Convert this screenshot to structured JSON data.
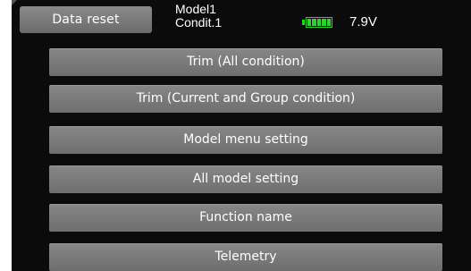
{
  "header": {
    "title": "Data reset",
    "model_name": "Model1",
    "condition": "Condit.1",
    "voltage": "7.9V",
    "battery_icon": "battery-icon",
    "battery_color": "#2bd42b"
  },
  "menu": {
    "items": [
      {
        "label": "Trim (All condition)"
      },
      {
        "label": "Trim (Current and Group condition)"
      },
      {
        "label": "Model menu setting"
      },
      {
        "label": "All model setting"
      },
      {
        "label": "Function name"
      },
      {
        "label": "Telemetry"
      }
    ]
  }
}
